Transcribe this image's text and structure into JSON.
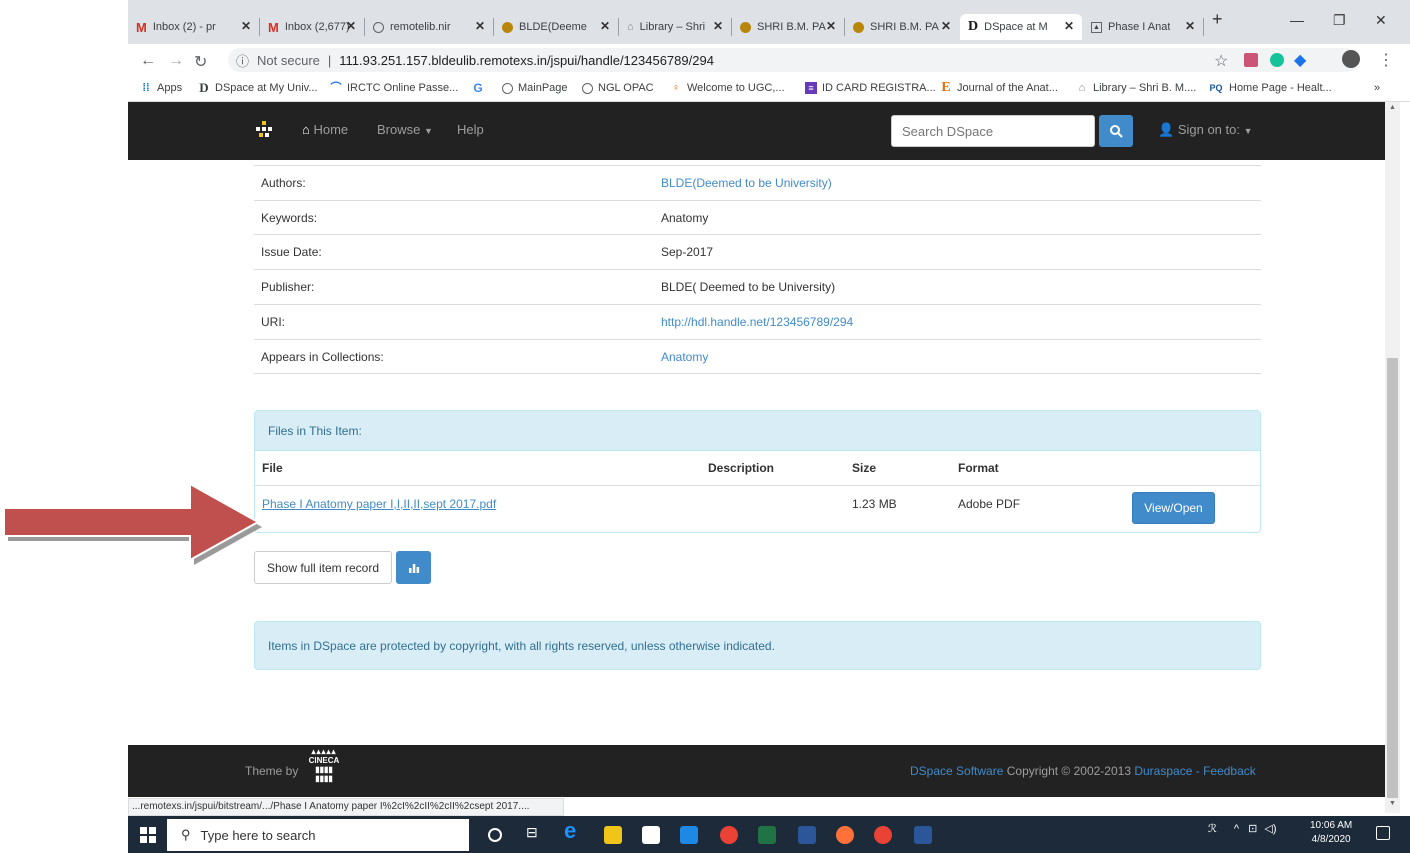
{
  "browser": {
    "tabs": [
      {
        "title": "Inbox (2) - pr",
        "icon": "gmail-icon",
        "active": false
      },
      {
        "title": "Inbox (2,677)",
        "icon": "gmail-icon",
        "active": false
      },
      {
        "title": "remotelib.nir",
        "icon": "globe-icon",
        "active": false
      },
      {
        "title": "BLDE(Deeme",
        "icon": "blde-icon",
        "active": false
      },
      {
        "title": "Library – Shri",
        "icon": "library-icon",
        "active": false
      },
      {
        "title": "SHRI B.M. PA",
        "icon": "blde-icon",
        "active": false
      },
      {
        "title": "SHRI B.M. PA",
        "icon": "blde-icon",
        "active": false
      },
      {
        "title": "DSpace at M",
        "icon": "dspace-icon",
        "active": true
      },
      {
        "title": "Phase I Anat",
        "icon": "pdf-icon",
        "active": false
      }
    ],
    "new_tab": "+",
    "url_secure_label": "Not secure",
    "url": "111.93.251.157.bldeulib.remotexs.in/jspui/handle/123456789/294",
    "bookmarks": [
      {
        "label": "Apps",
        "icon": "apps-grid-icon"
      },
      {
        "label": "DSpace at My Univ...",
        "icon": "dspace-icon"
      },
      {
        "label": "IRCTC Online Passe...",
        "icon": "irctc-icon"
      },
      {
        "label": "",
        "icon": "google-icon"
      },
      {
        "label": "MainPage",
        "icon": "globe-icon"
      },
      {
        "label": "NGL OPAC",
        "icon": "globe-icon"
      },
      {
        "label": "Welcome to UGC,...",
        "icon": "ugc-icon"
      },
      {
        "label": "ID CARD REGISTRA...",
        "icon": "form-icon"
      },
      {
        "label": "Journal of the Anat...",
        "icon": "journal-icon"
      },
      {
        "label": "Library – Shri B. M....",
        "icon": "library-icon"
      },
      {
        "label": "Home Page - Healt...",
        "icon": "pq-icon"
      }
    ],
    "bookmarks_more": "»",
    "status_url": "...remotexs.in/jspui/bitstream/.../Phase I Anatomy paper I%2cI%2cII%2cII%2csept 2017...."
  },
  "navbar": {
    "home": "Home",
    "browse": "Browse",
    "help": "Help",
    "search_placeholder": "Search DSpace",
    "sign_on": "Sign on to:"
  },
  "metadata": [
    {
      "label": "Authors:",
      "value": "BLDE(Deemed to be University)",
      "link": true
    },
    {
      "label": "Keywords:",
      "value": "Anatomy",
      "link": false
    },
    {
      "label": "Issue Date:",
      "value": "Sep-2017",
      "link": false
    },
    {
      "label": "Publisher:",
      "value": "BLDE( Deemed to be University)",
      "link": false
    },
    {
      "label": "URI:",
      "value": "http://hdl.handle.net/123456789/294",
      "link": true
    },
    {
      "label": "Appears in Collections:",
      "value": "Anatomy",
      "link": true
    }
  ],
  "files": {
    "heading": "Files in This Item:",
    "columns": {
      "file": "File",
      "description": "Description",
      "size": "Size",
      "format": "Format"
    },
    "row": {
      "name": "Phase I Anatomy paper I,I,II,II,sept 2017.pdf",
      "description": "",
      "size": "1.23 MB",
      "format": "Adobe PDF",
      "action": "View/Open"
    }
  },
  "actions": {
    "show_full": "Show full item record"
  },
  "copyright_notice": "Items in DSpace are protected by copyright, with all rights reserved, unless otherwise indicated.",
  "footer": {
    "theme_by": "Theme by",
    "logo_text": "CINECA",
    "dspace_software": "DSpace Software",
    "copyright": "Copyright © 2002-2013",
    "duraspace": "Duraspace",
    "sep": "-",
    "feedback": "Feedback"
  },
  "taskbar": {
    "search_placeholder": "Type here to search",
    "time": "10:06 AM",
    "date": "4/8/2020"
  },
  "colors": {
    "navbar_bg": "#222222",
    "link": "#428bca",
    "panel_info_bg": "#d9edf7",
    "arrow": "#c0504d"
  }
}
